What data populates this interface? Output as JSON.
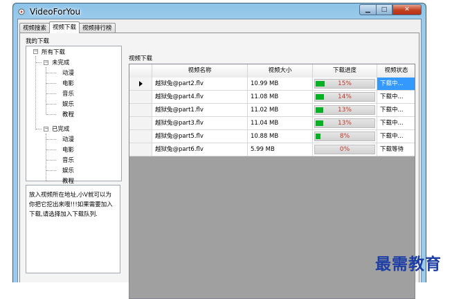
{
  "window": {
    "title": "VideoForYou"
  },
  "tabs": [
    {
      "label": "视频搜索"
    },
    {
      "label": "视频下载"
    },
    {
      "label": "视频排行榜"
    }
  ],
  "left": {
    "group_label": "我的下载",
    "tree": {
      "root": "所有下载",
      "groups": [
        {
          "label": "未完成",
          "children": [
            "动漫",
            "电影",
            "音乐",
            "娱乐",
            "教程"
          ]
        },
        {
          "label": "已完成",
          "children": [
            "动漫",
            "电影",
            "音乐",
            "娱乐",
            "教程"
          ]
        }
      ]
    },
    "description": "放入视频所在地址,小V就可以为你把它挖出来哦!!!如果需要加入下载,请选择加入下载队列."
  },
  "downloads": {
    "group_label": "视频下载",
    "columns": [
      "视频名称",
      "视频大小",
      "下载进度",
      "视频状态"
    ],
    "rows": [
      {
        "name": "越狱兔@part2.flv",
        "size": "10.99 MB",
        "progress": 15,
        "progress_label": "15%",
        "status": "下载中..."
      },
      {
        "name": "越狱兔@part4.flv",
        "size": "11.08 MB",
        "progress": 14,
        "progress_label": "14%",
        "status": "下载中..."
      },
      {
        "name": "越狱兔@part1.flv",
        "size": "11.02 MB",
        "progress": 13,
        "progress_label": "13%",
        "status": "下载中..."
      },
      {
        "name": "越狱兔@part3.flv",
        "size": "11.04 MB",
        "progress": 13,
        "progress_label": "13%",
        "status": "下载中..."
      },
      {
        "name": "越狱兔@part5.flv",
        "size": "10.88 MB",
        "progress": 8,
        "progress_label": "8%",
        "status": "下载中..."
      },
      {
        "name": "越狱兔@part6.flv",
        "size": "5.99 MB",
        "progress": 0,
        "progress_label": "0%",
        "status": "下载等待"
      }
    ],
    "selected_row": 0
  },
  "watermark": "最需教育",
  "colors": {
    "progress_fill": "#06b025",
    "progress_text": "#c0392b",
    "selection": "#3399ff"
  }
}
